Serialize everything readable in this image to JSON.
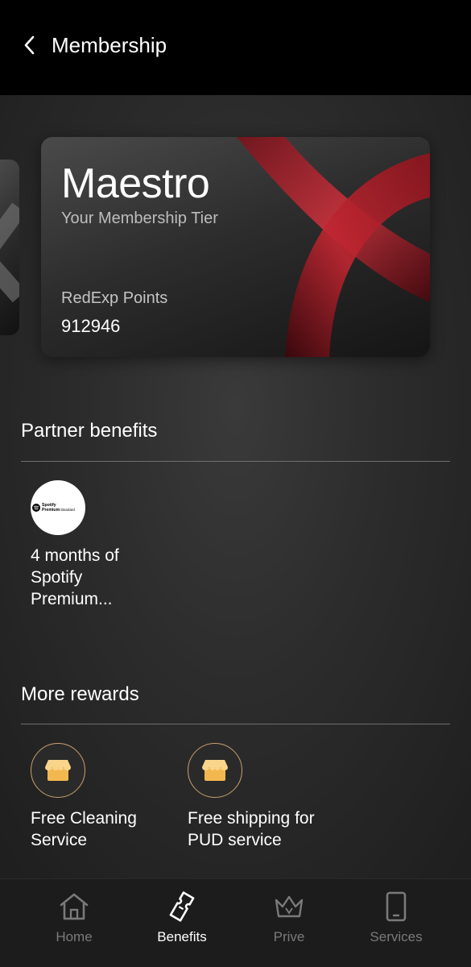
{
  "header": {
    "title": "Membership",
    "back_icon": "chevron-left-icon"
  },
  "card": {
    "tier": "Maestro",
    "subtitle": "Your Membership Tier",
    "points_label": "RedExp Points",
    "points_value": "912946",
    "accent_color": "#c41e2a"
  },
  "partner_benefits": {
    "title": "Partner benefits",
    "items": [
      {
        "text": "4 months of Spotify Premium...",
        "logo_line1": "Spotify",
        "logo_line2": "Premium",
        "logo_line3": "Standard",
        "icon": "spotify-icon"
      }
    ]
  },
  "more_rewards": {
    "title": "More rewards",
    "items": [
      {
        "text": "Free Cleaning Service",
        "icon": "store-icon"
      },
      {
        "text": "Free shipping for PUD service",
        "icon": "store-icon"
      }
    ]
  },
  "nav": {
    "items": [
      {
        "label": "Home",
        "icon": "home-icon",
        "active": false
      },
      {
        "label": "Benefits",
        "icon": "ticket-icon",
        "active": true
      },
      {
        "label": "Prive",
        "icon": "crown-icon",
        "active": false
      },
      {
        "label": "Services",
        "icon": "phone-icon",
        "active": false
      }
    ]
  },
  "colors": {
    "background": "#2c2c2c",
    "header": "#000000",
    "nav_bg": "#1c1c1c",
    "reward_ring": "#caa06e",
    "store_icon": "#f4c46a"
  }
}
